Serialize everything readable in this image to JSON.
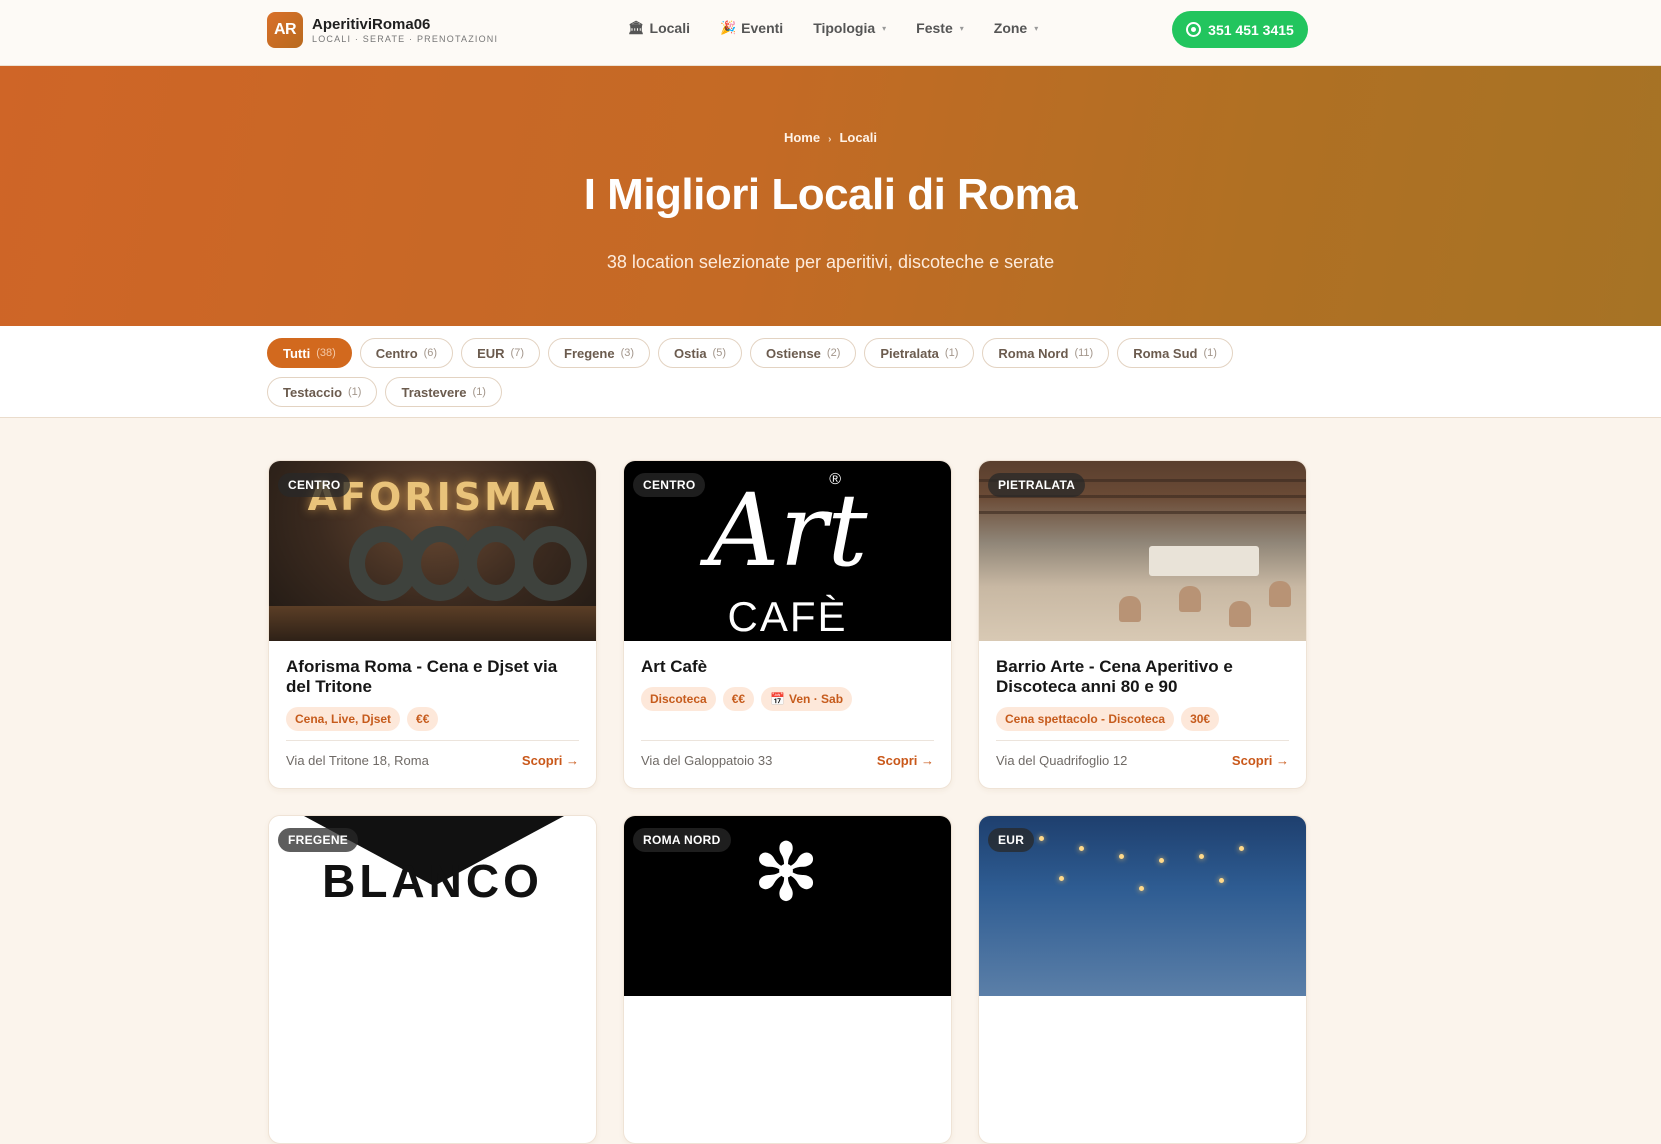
{
  "header": {
    "logo_badge": "AR",
    "brand_name": "AperitiviRoma06",
    "brand_tagline": "LOCALI · SERATE · PRENOTAZIONI",
    "nav": [
      {
        "label": "Locali",
        "icon": "building-icon"
      },
      {
        "label": "Eventi",
        "icon": "party-icon"
      },
      {
        "label": "Tipologia",
        "icon": "chevron-down-icon"
      },
      {
        "label": "Feste",
        "icon": "chevron-down-icon"
      },
      {
        "label": "Zone",
        "icon": "chevron-down-icon"
      }
    ],
    "whatsapp_phone": "351 451 3415"
  },
  "hero": {
    "breadcrumb": [
      "Home",
      "Locali"
    ],
    "title": "I Migliori Locali di Roma",
    "subtitle": "38 location selezionate per aperitivi, discoteche e serate"
  },
  "filters": [
    {
      "label": "Tutti",
      "count": "(38)",
      "active": true
    },
    {
      "label": "Centro",
      "count": "(6)"
    },
    {
      "label": "EUR",
      "count": "(7)"
    },
    {
      "label": "Fregene",
      "count": "(3)"
    },
    {
      "label": "Ostia",
      "count": "(5)"
    },
    {
      "label": "Ostiense",
      "count": "(2)"
    },
    {
      "label": "Pietralata",
      "count": "(1)"
    },
    {
      "label": "Roma Nord",
      "count": "(11)"
    },
    {
      "label": "Roma Sud",
      "count": "(1)"
    },
    {
      "label": "Testaccio",
      "count": "(1)"
    },
    {
      "label": "Trastevere",
      "count": "(1)"
    }
  ],
  "cards": [
    {
      "zone": "CENTRO",
      "image_text": "AFORISMA",
      "title": "Aforisma Roma - Cena e Djset via del Tritone",
      "tags": [
        "Cena, Live, Djset",
        "€€"
      ],
      "address": "Via del Tritone 18, Roma",
      "cta": "Scopri →"
    },
    {
      "zone": "CENTRO",
      "image_text": "Art",
      "image_text_2": "CAFÈ",
      "image_mark": "®",
      "title": "Art Cafè",
      "tags": [
        "Discoteca",
        "€€",
        "Ven · Sab"
      ],
      "address": "Via del Galoppatoio 33",
      "cta": "Scopri →"
    },
    {
      "zone": "PIETRALATA",
      "title": "Barrio Arte - Cena Aperitivo e Discoteca anni 80 e 90",
      "tags": [
        "Cena spettacolo - Discoteca",
        "30€"
      ],
      "address": "Via del Quadrifoglio 12",
      "cta": "Scopri →"
    },
    {
      "zone": "FREGENE",
      "image_text": "BLANCO"
    },
    {
      "zone": "ROMA NORD"
    },
    {
      "zone": "EUR"
    }
  ],
  "colors": {
    "accent": "#d2691e",
    "whatsapp": "#22c55e",
    "tag_bg": "#fde8da"
  }
}
